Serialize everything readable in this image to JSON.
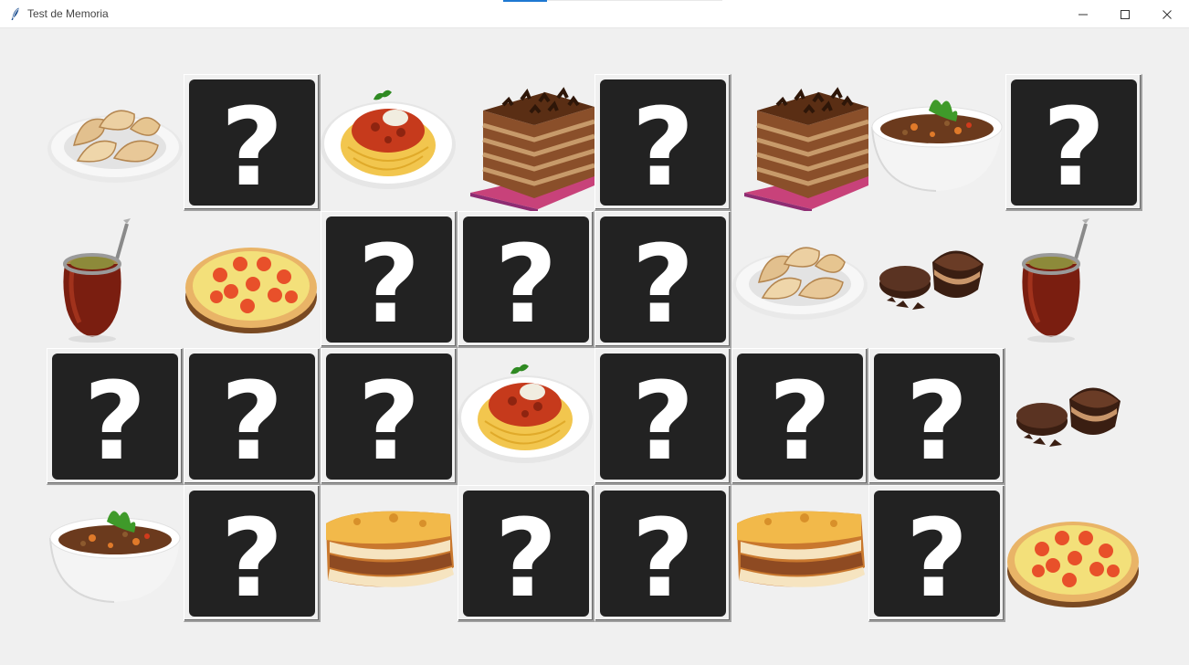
{
  "window": {
    "title": "Test de Memoria",
    "icon": "feather-icon"
  },
  "board": {
    "rows": 4,
    "cols": 8,
    "hidden_symbol": "?",
    "cells": [
      [
        "empanadas",
        "hidden",
        "spaghetti",
        "chocotorta",
        "hidden",
        "chocotorta",
        "lentil-stew",
        "hidden"
      ],
      [
        "mate",
        "pizza",
        "hidden",
        "hidden",
        "hidden",
        "empanadas",
        "alfajor",
        "mate"
      ],
      [
        "hidden",
        "hidden",
        "hidden",
        "spaghetti",
        "hidden",
        "hidden",
        "hidden",
        "alfajor"
      ],
      [
        "lentil-stew",
        "hidden",
        "lasagna",
        "hidden",
        "hidden",
        "lasagna",
        "hidden",
        "pizza"
      ]
    ]
  }
}
